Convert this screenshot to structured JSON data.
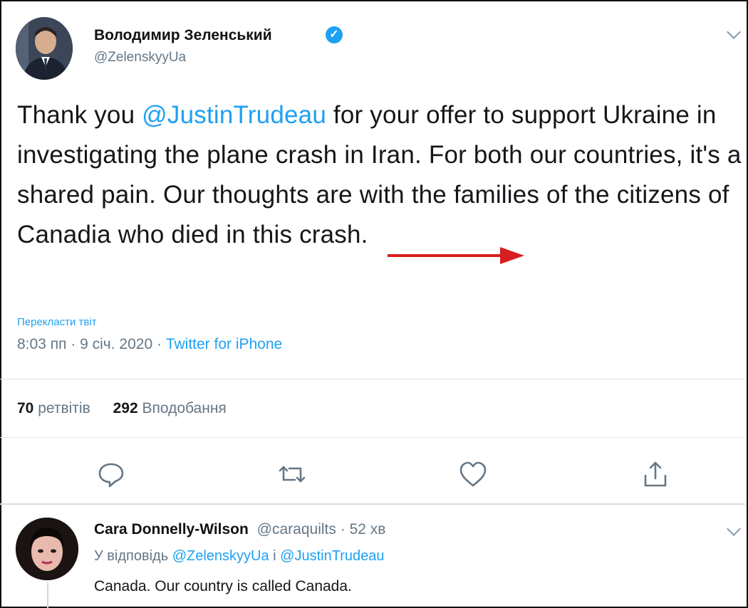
{
  "tweet": {
    "author_name": "Володимир Зеленський",
    "author_handle": "@ZelenskyyUa",
    "text_segments": [
      "Thank you ",
      "@JustinTrudeau",
      " for your offer to support Ukraine in investigating the plane crash in Iran. For both our countries, it's a shared pain. Our thoughts are with the families of the citizens of Canadia who died in this crash."
    ],
    "translate_link": "Перекласти твіт",
    "time": "8:03 пп",
    "separator": " · ",
    "date": "9 січ. 2020",
    "source": "Twitter for iPhone",
    "retweets_count": "70",
    "retweets_label": "ретвітів",
    "likes_count": "292",
    "likes_label": "Вподобання",
    "actions": [
      "reply-icon",
      "retweet-icon",
      "like-icon",
      "share-icon"
    ]
  },
  "reply": {
    "author_name": "Cara Donnelly-Wilson",
    "author_handle": "@caraquilts",
    "age": "52 хв",
    "replying_prefix": "У відповідь",
    "replying_mention_1": "@ZelenskyyUa",
    "replying_joiner": "і",
    "replying_mention_2": "@JustinTrudeau",
    "text": "Canada. Our country is called Canada."
  },
  "annotation": {
    "arrow_color": "#d81e1e"
  },
  "colors": {
    "link": "#1da1f2",
    "muted": "#657786",
    "verified": "#1da1f2"
  }
}
